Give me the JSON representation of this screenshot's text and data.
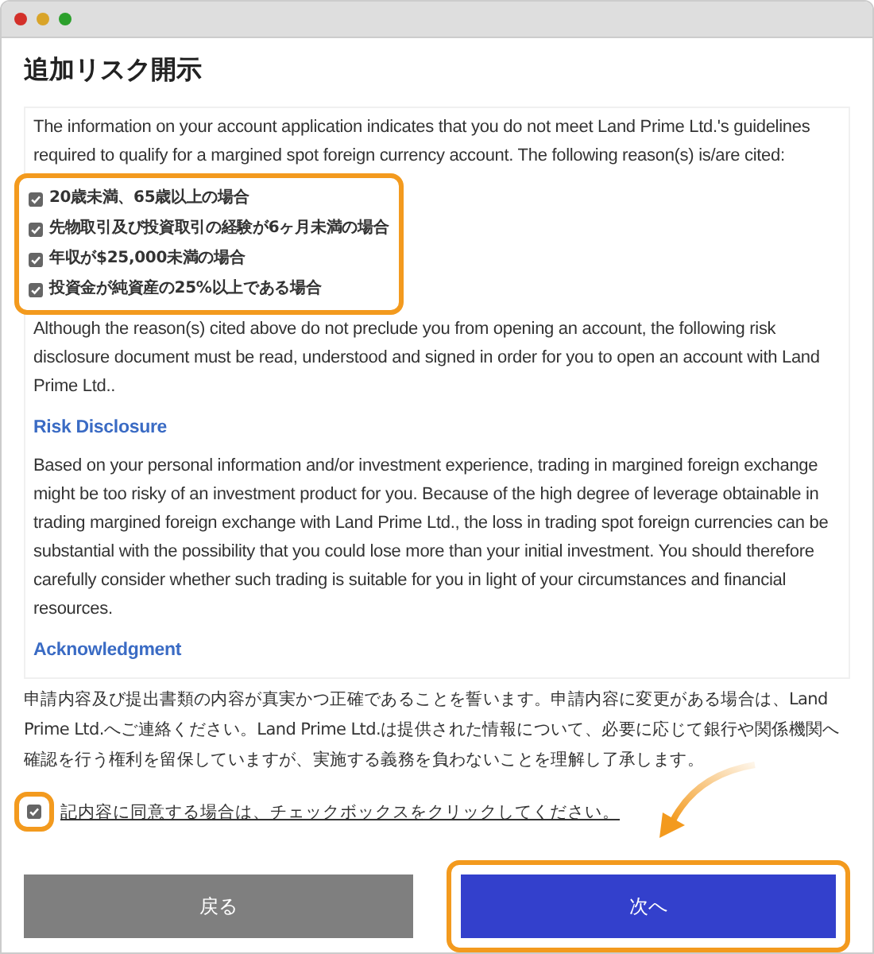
{
  "window": {
    "title": "追加リスク開示"
  },
  "disclosure": {
    "intro": "The information on your account application indicates that you do not meet Land Prime Ltd.'s guidelines required to qualify for a margined spot foreign currency account. The following reason(s) is/are cited:",
    "reasons_highlighted": true,
    "reasons": [
      {
        "label": "20歳未満、65歳以上の場合",
        "checked": true
      },
      {
        "label": "先物取引及び投資取引の経験が6ヶ月未満の場合",
        "checked": true
      },
      {
        "label": "年収が$25,000未満の場合",
        "checked": true
      },
      {
        "label": "投資金が純資産の25%以上である場合",
        "checked": true
      }
    ],
    "notice": "Although the reason(s) cited above do not preclude you from opening an account, the following risk disclosure document must be read, understood and signed in order for you to open an account with Land Prime Ltd..",
    "sections": [
      {
        "heading": "Risk Disclosure",
        "body": "Based on your personal information and/or investment experience, trading in margined foreign exchange might be too risky of an investment product for you. Because of the high degree of leverage obtainable in trading margined foreign exchange with Land Prime Ltd., the loss in trading spot foreign currencies can be substantial with the possibility that you could lose more than your initial investment. You should therefore carefully consider whether such trading is suitable for you in light of your circumstances and financial resources."
      },
      {
        "heading": "Acknowledgment"
      }
    ]
  },
  "declaration": "申請内容及び提出書類の内容が真実かつ正確であることを誓います。申請内容に変更がある場合は、Land Prime Ltd.へご連絡ください。Land Prime Ltd.は提供された情報について、必要に応じて銀行や関係機関へ確認を行う権利を留保していますが、実施する義務を負わないことを理解し了承します。",
  "agree": {
    "label": "記内容に同意する場合は、チェックボックスをクリックしてください。",
    "checked": true,
    "highlighted": true
  },
  "buttons": [
    {
      "label": "戻る",
      "kind": "back",
      "highlighted": false
    },
    {
      "label": "次へ",
      "kind": "next",
      "highlighted": true
    }
  ]
}
